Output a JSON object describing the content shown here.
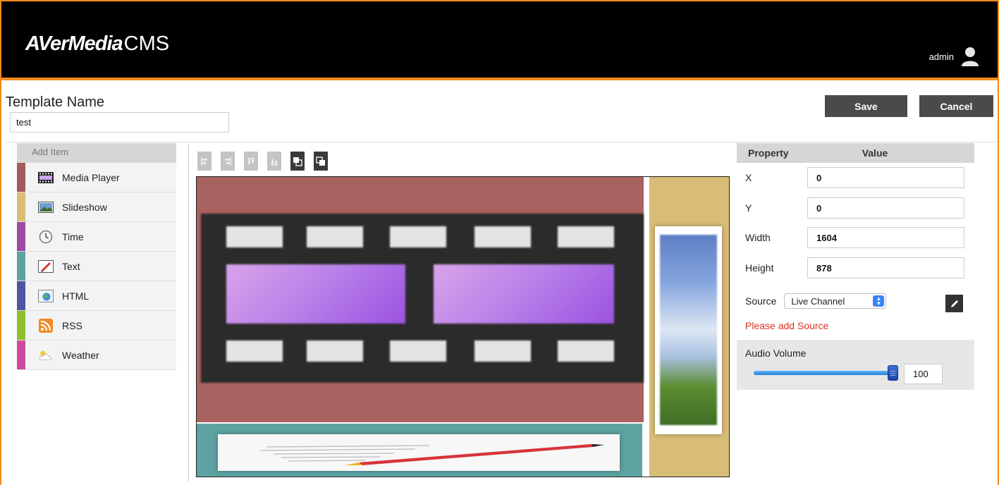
{
  "header": {
    "brand": "AVerMedia",
    "brand_suffix": "CMS",
    "user": "admin"
  },
  "template": {
    "label": "Template Name",
    "name_value": "test"
  },
  "actions": {
    "save": "Save",
    "cancel": "Cancel"
  },
  "sidebar": {
    "title": "Add Item",
    "items": [
      {
        "label": "Media Player",
        "color": "#a35a5a",
        "icon": "film-icon"
      },
      {
        "label": "Slideshow",
        "color": "#d8bd78",
        "icon": "picture-icon"
      },
      {
        "label": "Time",
        "color": "#9c4aa3",
        "icon": "clock-icon"
      },
      {
        "label": "Text",
        "color": "#5ea3a2",
        "icon": "pencil-icon"
      },
      {
        "label": "HTML",
        "color": "#4d56a1",
        "icon": "globe-icon"
      },
      {
        "label": "RSS",
        "color": "#8cbf2b",
        "icon": "rss-icon"
      },
      {
        "label": "Weather",
        "color": "#cc4b9a",
        "icon": "weather-icon"
      }
    ]
  },
  "toolbar": {
    "buttons": [
      "align-left-icon",
      "align-right-icon",
      "align-top-icon",
      "align-bottom-icon",
      "bring-forward-icon",
      "send-backward-icon"
    ]
  },
  "properties": {
    "header_property": "Property",
    "header_value": "Value",
    "x_label": "X",
    "x_value": "0",
    "y_label": "Y",
    "y_value": "0",
    "width_label": "Width",
    "width_value": "1604",
    "height_label": "Height",
    "height_value": "878",
    "source_label": "Source",
    "source_value": "Live Channel",
    "warning": "Please add Source",
    "audio_label": "Audio Volume",
    "audio_value": "100",
    "audio_level": 1.0
  },
  "colors": {
    "accent": "#f28a1c",
    "warning": "#d8341e",
    "slider": "#1d84dc"
  }
}
